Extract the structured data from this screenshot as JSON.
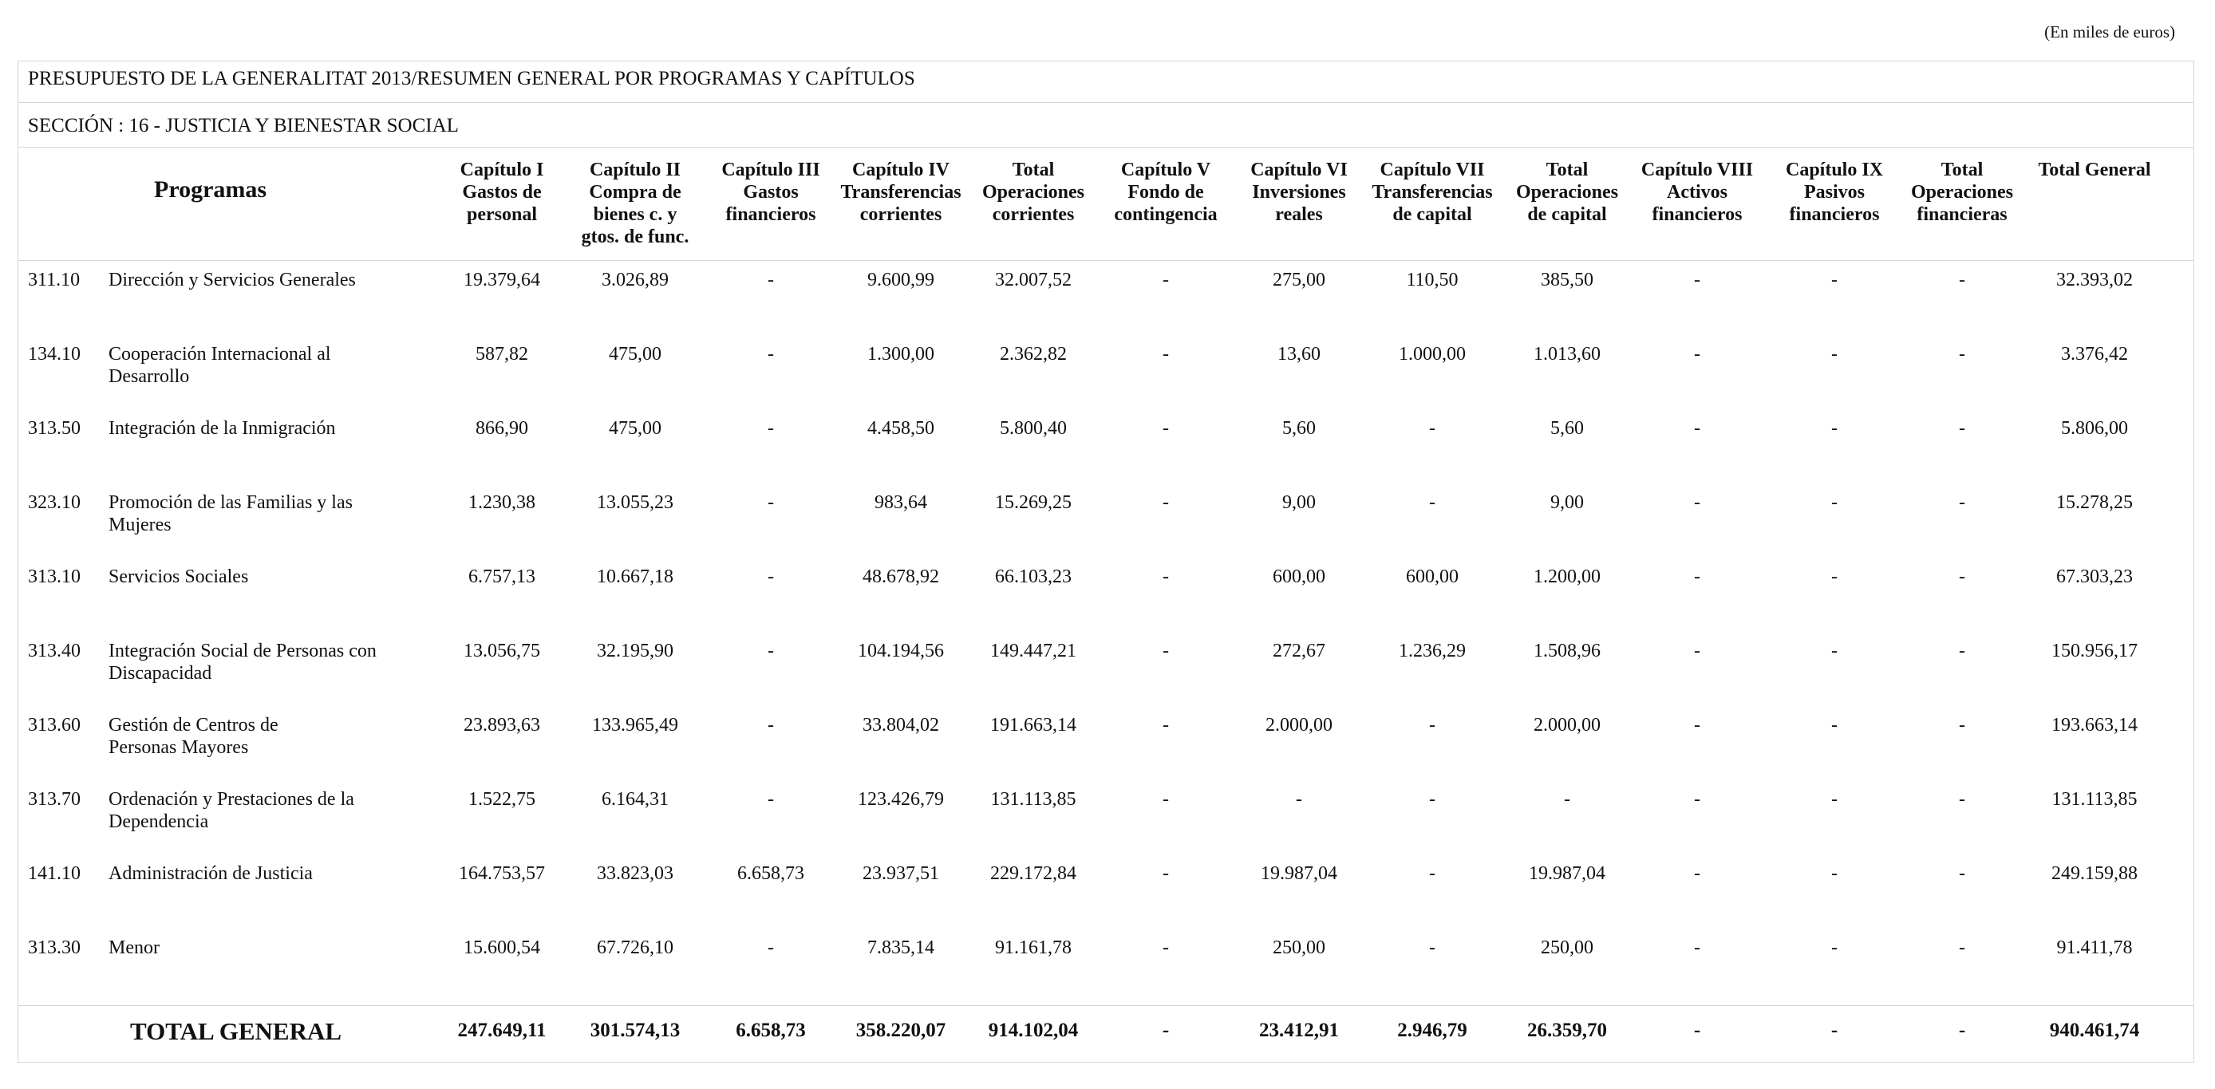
{
  "unit_note": "(En miles de euros)",
  "title": "PRESUPUESTO DE LA GENERALITAT 2013/RESUMEN GENERAL POR PROGRAMAS Y CAPÍTULOS",
  "section": "SECCIÓN : 16  -  JUSTICIA Y BIENESTAR SOCIAL",
  "header": {
    "programas": "Programas",
    "columns": [
      "Capítulo I\nGastos de\npersonal",
      "Capítulo II\nCompra de\nbienes c. y\ngtos. de func.",
      "Capítulo III\nGastos\nfinancieros",
      "Capítulo IV\nTransferencias\ncorrientes",
      "Total\nOperaciones\ncorrientes",
      "Capítulo V\nFondo de\ncontingencia",
      "Capítulo VI\nInversiones\nreales",
      "Capítulo VII\nTransferencias\nde capital",
      "Total\nOperaciones\nde capital",
      "Capítulo VIII\nActivos\nfinancieros",
      "Capítulo IX\nPasivos\nfinancieros",
      "Total\nOperaciones\nfinancieras",
      "Total General"
    ]
  },
  "rows": [
    {
      "code": "311.10",
      "name": "Dirección y Servicios Generales",
      "values": [
        "19.379,64",
        "3.026,89",
        "-",
        "9.600,99",
        "32.007,52",
        "-",
        "275,00",
        "110,50",
        "385,50",
        "-",
        "-",
        "-",
        "32.393,02"
      ]
    },
    {
      "code": "134.10",
      "name": "Cooperación Internacional al\nDesarrollo",
      "values": [
        "587,82",
        "475,00",
        "-",
        "1.300,00",
        "2.362,82",
        "-",
        "13,60",
        "1.000,00",
        "1.013,60",
        "-",
        "-",
        "-",
        "3.376,42"
      ]
    },
    {
      "code": "313.50",
      "name": "Integración de la Inmigración",
      "values": [
        "866,90",
        "475,00",
        "-",
        "4.458,50",
        "5.800,40",
        "-",
        "5,60",
        "-",
        "5,60",
        "-",
        "-",
        "-",
        "5.806,00"
      ]
    },
    {
      "code": "323.10",
      "name": "Promoción de las Familias y las\nMujeres",
      "values": [
        "1.230,38",
        "13.055,23",
        "-",
        "983,64",
        "15.269,25",
        "-",
        "9,00",
        "-",
        "9,00",
        "-",
        "-",
        "-",
        "15.278,25"
      ]
    },
    {
      "code": "313.10",
      "name": "Servicios Sociales",
      "values": [
        "6.757,13",
        "10.667,18",
        "-",
        "48.678,92",
        "66.103,23",
        "-",
        "600,00",
        "600,00",
        "1.200,00",
        "-",
        "-",
        "-",
        "67.303,23"
      ]
    },
    {
      "code": "313.40",
      "name": "Integración Social de Personas con\nDiscapacidad",
      "values": [
        "13.056,75",
        "32.195,90",
        "-",
        "104.194,56",
        "149.447,21",
        "-",
        "272,67",
        "1.236,29",
        "1.508,96",
        "-",
        "-",
        "-",
        "150.956,17"
      ]
    },
    {
      "code": "313.60",
      "name": "Gestión de Centros de\nPersonas Mayores",
      "values": [
        "23.893,63",
        "133.965,49",
        "-",
        "33.804,02",
        "191.663,14",
        "-",
        "2.000,00",
        "-",
        "2.000,00",
        "-",
        "-",
        "-",
        "193.663,14"
      ]
    },
    {
      "code": "313.70",
      "name": "Ordenación y Prestaciones de la\nDependencia",
      "values": [
        "1.522,75",
        "6.164,31",
        "-",
        "123.426,79",
        "131.113,85",
        "-",
        "-",
        "-",
        "-",
        "-",
        "-",
        "-",
        "131.113,85"
      ]
    },
    {
      "code": "141.10",
      "name": "Administración de Justicia",
      "values": [
        "164.753,57",
        "33.823,03",
        "6.658,73",
        "23.937,51",
        "229.172,84",
        "-",
        "19.987,04",
        "-",
        "19.987,04",
        "-",
        "-",
        "-",
        "249.159,88"
      ]
    },
    {
      "code": "313.30",
      "name": "Menor",
      "values": [
        "15.600,54",
        "67.726,10",
        "-",
        "7.835,14",
        "91.161,78",
        "-",
        "250,00",
        "-",
        "250,00",
        "-",
        "-",
        "-",
        "91.411,78"
      ]
    }
  ],
  "total": {
    "label": "TOTAL GENERAL",
    "values": [
      "247.649,11",
      "301.574,13",
      "6.658,73",
      "358.220,07",
      "914.102,04",
      "-",
      "23.412,91",
      "2.946,79",
      "26.359,70",
      "-",
      "-",
      "-",
      "940.461,74"
    ]
  }
}
